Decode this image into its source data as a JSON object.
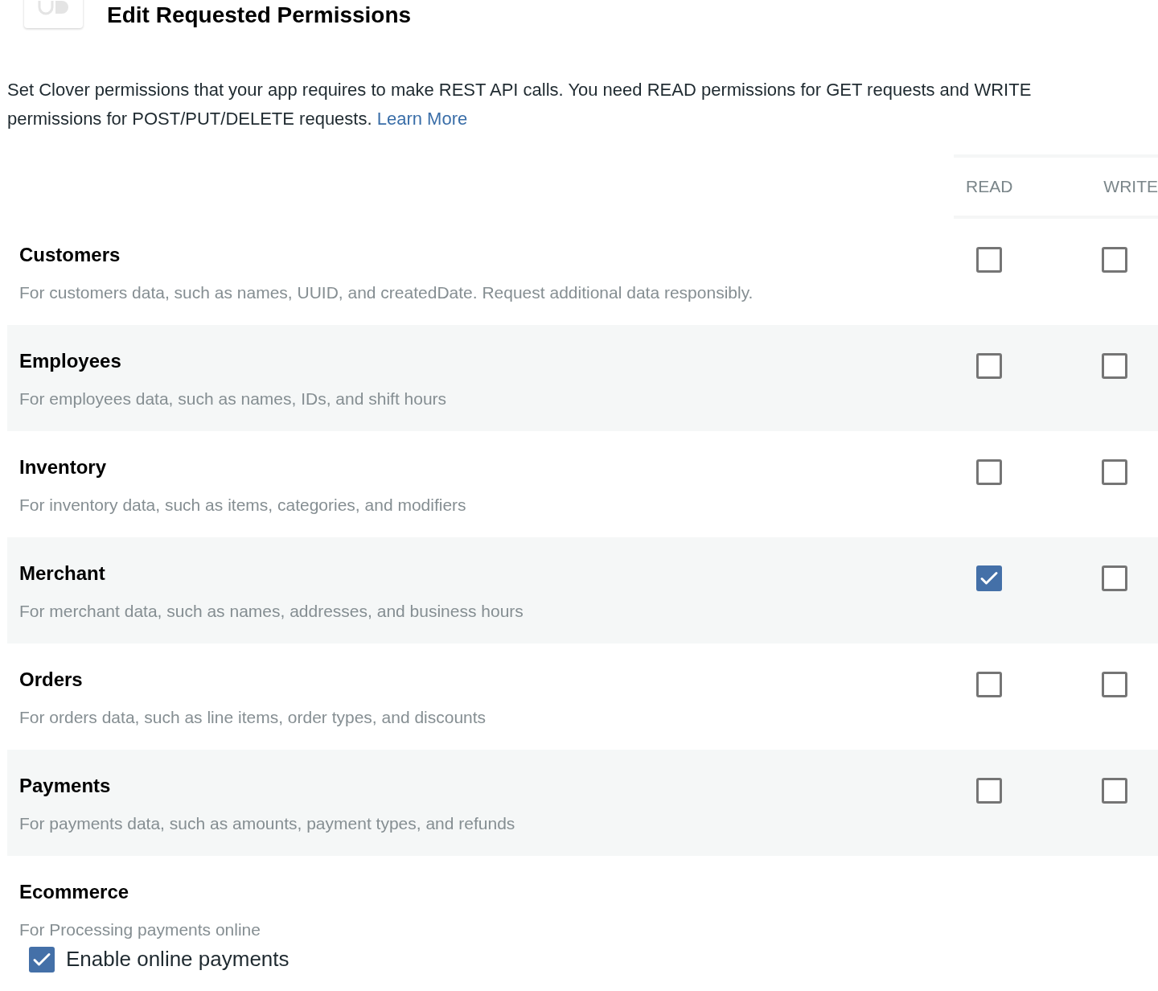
{
  "title": "Edit Requested Permissions",
  "intro": "Set Clover permissions that your app requires to make REST API calls. You need READ permissions for GET requests and WRITE permissions for POST/PUT/DELETE requests.",
  "learn_more": "Learn More",
  "columns": [
    "READ",
    "WRITE"
  ],
  "rows": [
    {
      "kind": "permission",
      "name": "Customers",
      "description": "For customers data, such as names, UUID, and createdDate. Request additional data responsibly.",
      "read": {
        "checked": false
      },
      "write": {
        "checked": false
      }
    },
    {
      "kind": "permission",
      "name": "Employees",
      "description": "For employees data, such as names, IDs, and shift hours",
      "read": {
        "checked": false
      },
      "write": {
        "checked": false
      }
    },
    {
      "kind": "permission",
      "name": "Inventory",
      "description": "For inventory data, such as items, categories, and modifiers",
      "read": {
        "checked": false
      },
      "write": {
        "checked": false
      }
    },
    {
      "kind": "permission",
      "name": "Merchant",
      "description": "For merchant data, such as names, addresses, and business hours",
      "read": {
        "checked": true
      },
      "write": {
        "checked": false
      }
    },
    {
      "kind": "permission",
      "name": "Orders",
      "description": "For orders data, such as line items, order types, and discounts",
      "read": {
        "checked": false
      },
      "write": {
        "checked": false
      }
    },
    {
      "kind": "permission",
      "name": "Payments",
      "description": "For payments data, such as amounts, payment types, and refunds",
      "read": {
        "checked": false
      },
      "write": {
        "checked": false
      }
    },
    {
      "kind": "option",
      "name": "Ecommerce",
      "description": "For Processing payments online",
      "option": {
        "label": "Enable online payments",
        "checked": true
      }
    }
  ]
}
